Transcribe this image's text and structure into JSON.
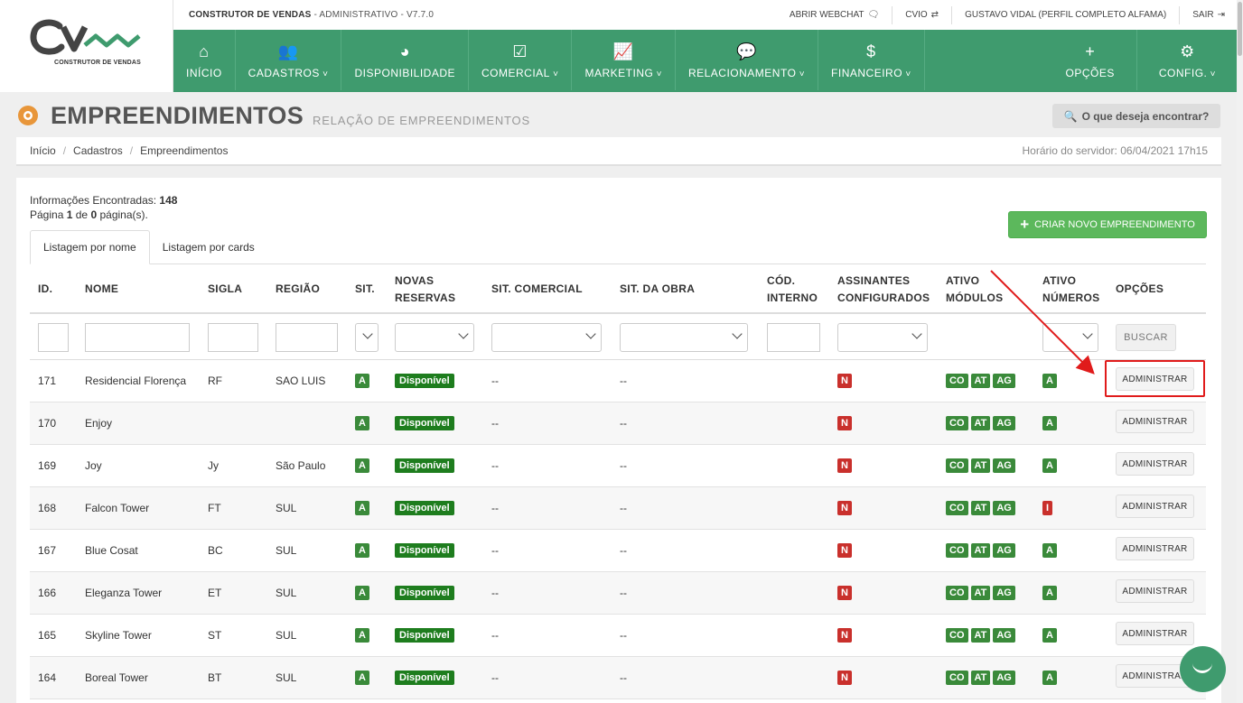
{
  "app": {
    "name": "CONSTRUTOR DE VENDAS",
    "suffix": " - ADMINISTRATIVO - V7.7.0",
    "logo_text": "CONSTRUTOR DE VENDAS"
  },
  "top_links": [
    {
      "label": "ABRIR WEBCHAT",
      "icon": "chat-icon"
    },
    {
      "label": "CVIO",
      "icon": "exchange-icon"
    },
    {
      "label": "GUSTAVO VIDAL (PERFIL COMPLETO ALFAMA)",
      "icon": ""
    },
    {
      "label": "SAIR",
      "icon": "logout-icon"
    }
  ],
  "nav": [
    {
      "label": "INÍCIO",
      "icon": "home-icon",
      "glyph": "⌂",
      "dropdown": false
    },
    {
      "label": "CADASTROS",
      "icon": "users-icon",
      "glyph": "👥",
      "dropdown": true
    },
    {
      "label": "DISPONIBILIDADE",
      "icon": "dashboard-icon",
      "glyph": "◕",
      "dropdown": false
    },
    {
      "label": "COMERCIAL",
      "icon": "check-square-icon",
      "glyph": "☑",
      "dropdown": true
    },
    {
      "label": "MARKETING",
      "icon": "line-chart-icon",
      "glyph": "📈",
      "dropdown": true
    },
    {
      "label": "RELACIONAMENTO",
      "icon": "comments-icon",
      "glyph": "💬",
      "dropdown": true
    },
    {
      "label": "FINANCEIRO",
      "icon": "dollar-icon",
      "glyph": "$",
      "dropdown": true
    }
  ],
  "nav_right": [
    {
      "label": "OPÇÕES",
      "icon": "plus-icon",
      "glyph": "+",
      "dropdown": false
    },
    {
      "label": "CONFIG.",
      "icon": "gear-icon",
      "glyph": "⚙",
      "dropdown": true
    }
  ],
  "page": {
    "title": "EMPREENDIMENTOS",
    "subtitle": "RELAÇÃO DE EMPREENDIMENTOS",
    "search_label": "O que deseja encontrar?"
  },
  "breadcrumb": [
    "Início",
    "Cadastros",
    "Empreendimentos"
  ],
  "server_time": "Horário do servidor: 06/04/2021 17h15",
  "info": {
    "found_label": "Informações Encontradas:",
    "found_count": "148",
    "page_prefix": "Página",
    "page_current": "1",
    "page_mid": "de",
    "page_total": "0",
    "page_suffix": "página(s)."
  },
  "create_button": "CRIAR NOVO EMPREENDIMENTO",
  "tabs": [
    "Listagem por nome",
    "Listagem por cards"
  ],
  "columns": [
    {
      "key": "id",
      "label": "ID."
    },
    {
      "key": "nome",
      "label": "NOME"
    },
    {
      "key": "sigla",
      "label": "SIGLA"
    },
    {
      "key": "regiao",
      "label": "REGIÃO"
    },
    {
      "key": "sit",
      "label": "SIT."
    },
    {
      "key": "novas",
      "label": "NOVAS RESERVAS"
    },
    {
      "key": "sit_comercial",
      "label": "SIT. COMERCIAL"
    },
    {
      "key": "sit_obra",
      "label": "SIT. DA OBRA"
    },
    {
      "key": "cod",
      "label": "CÓD. INTERNO"
    },
    {
      "key": "assinantes",
      "label": "ASSINANTES CONFIGURADOS"
    },
    {
      "key": "modulos",
      "label": "ATIVO MÓDULOS"
    },
    {
      "key": "numeros",
      "label": "ATIVO NÚMEROS"
    },
    {
      "key": "opcoes",
      "label": "OPÇÕES"
    }
  ],
  "search_button": "BUSCAR",
  "admin_button": "ADMINISTRAR",
  "rows": [
    {
      "id": "171",
      "nome": "Residencial Florença",
      "sigla": "RF",
      "regiao": "SAO LUIS",
      "sit": "A",
      "novas": "Disponível",
      "sit_comercial": "--",
      "sit_obra": "--",
      "assinantes": "N",
      "modulos": [
        "CO",
        "AT",
        "AG"
      ],
      "numeros": "A"
    },
    {
      "id": "170",
      "nome": "Enjoy",
      "sigla": "",
      "regiao": "",
      "sit": "A",
      "novas": "Disponível",
      "sit_comercial": "--",
      "sit_obra": "--",
      "assinantes": "N",
      "modulos": [
        "CO",
        "AT",
        "AG"
      ],
      "numeros": "A"
    },
    {
      "id": "169",
      "nome": "Joy",
      "sigla": "Jy",
      "regiao": "São Paulo",
      "sit": "A",
      "novas": "Disponível",
      "sit_comercial": "--",
      "sit_obra": "--",
      "assinantes": "N",
      "modulos": [
        "CO",
        "AT",
        "AG"
      ],
      "numeros": "A"
    },
    {
      "id": "168",
      "nome": "Falcon Tower",
      "sigla": "FT",
      "regiao": "SUL",
      "sit": "A",
      "novas": "Disponível",
      "sit_comercial": "--",
      "sit_obra": "--",
      "assinantes": "N",
      "modulos": [
        "CO",
        "AT",
        "AG"
      ],
      "numeros": "I"
    },
    {
      "id": "167",
      "nome": "Blue Cosat",
      "sigla": "BC",
      "regiao": "SUL",
      "sit": "A",
      "novas": "Disponível",
      "sit_comercial": "--",
      "sit_obra": "--",
      "assinantes": "N",
      "modulos": [
        "CO",
        "AT",
        "AG"
      ],
      "numeros": "A"
    },
    {
      "id": "166",
      "nome": "Eleganza Tower",
      "sigla": "ET",
      "regiao": "SUL",
      "sit": "A",
      "novas": "Disponível",
      "sit_comercial": "--",
      "sit_obra": "--",
      "assinantes": "N",
      "modulos": [
        "CO",
        "AT",
        "AG"
      ],
      "numeros": "A"
    },
    {
      "id": "165",
      "nome": "Skyline Tower",
      "sigla": "ST",
      "regiao": "SUL",
      "sit": "A",
      "novas": "Disponível",
      "sit_comercial": "--",
      "sit_obra": "--",
      "assinantes": "N",
      "modulos": [
        "CO",
        "AT",
        "AG"
      ],
      "numeros": "A"
    },
    {
      "id": "164",
      "nome": "Boreal Tower",
      "sigla": "BT",
      "regiao": "SUL",
      "sit": "A",
      "novas": "Disponível",
      "sit_comercial": "--",
      "sit_obra": "--",
      "assinantes": "N",
      "modulos": [
        "CO",
        "AT",
        "AG"
      ],
      "numeros": "A"
    }
  ],
  "colors": {
    "brand": "#3f9b6e",
    "badge_green": "#3a8a3a",
    "badge_red": "#c9302c",
    "annotation": "#e01b1b"
  }
}
